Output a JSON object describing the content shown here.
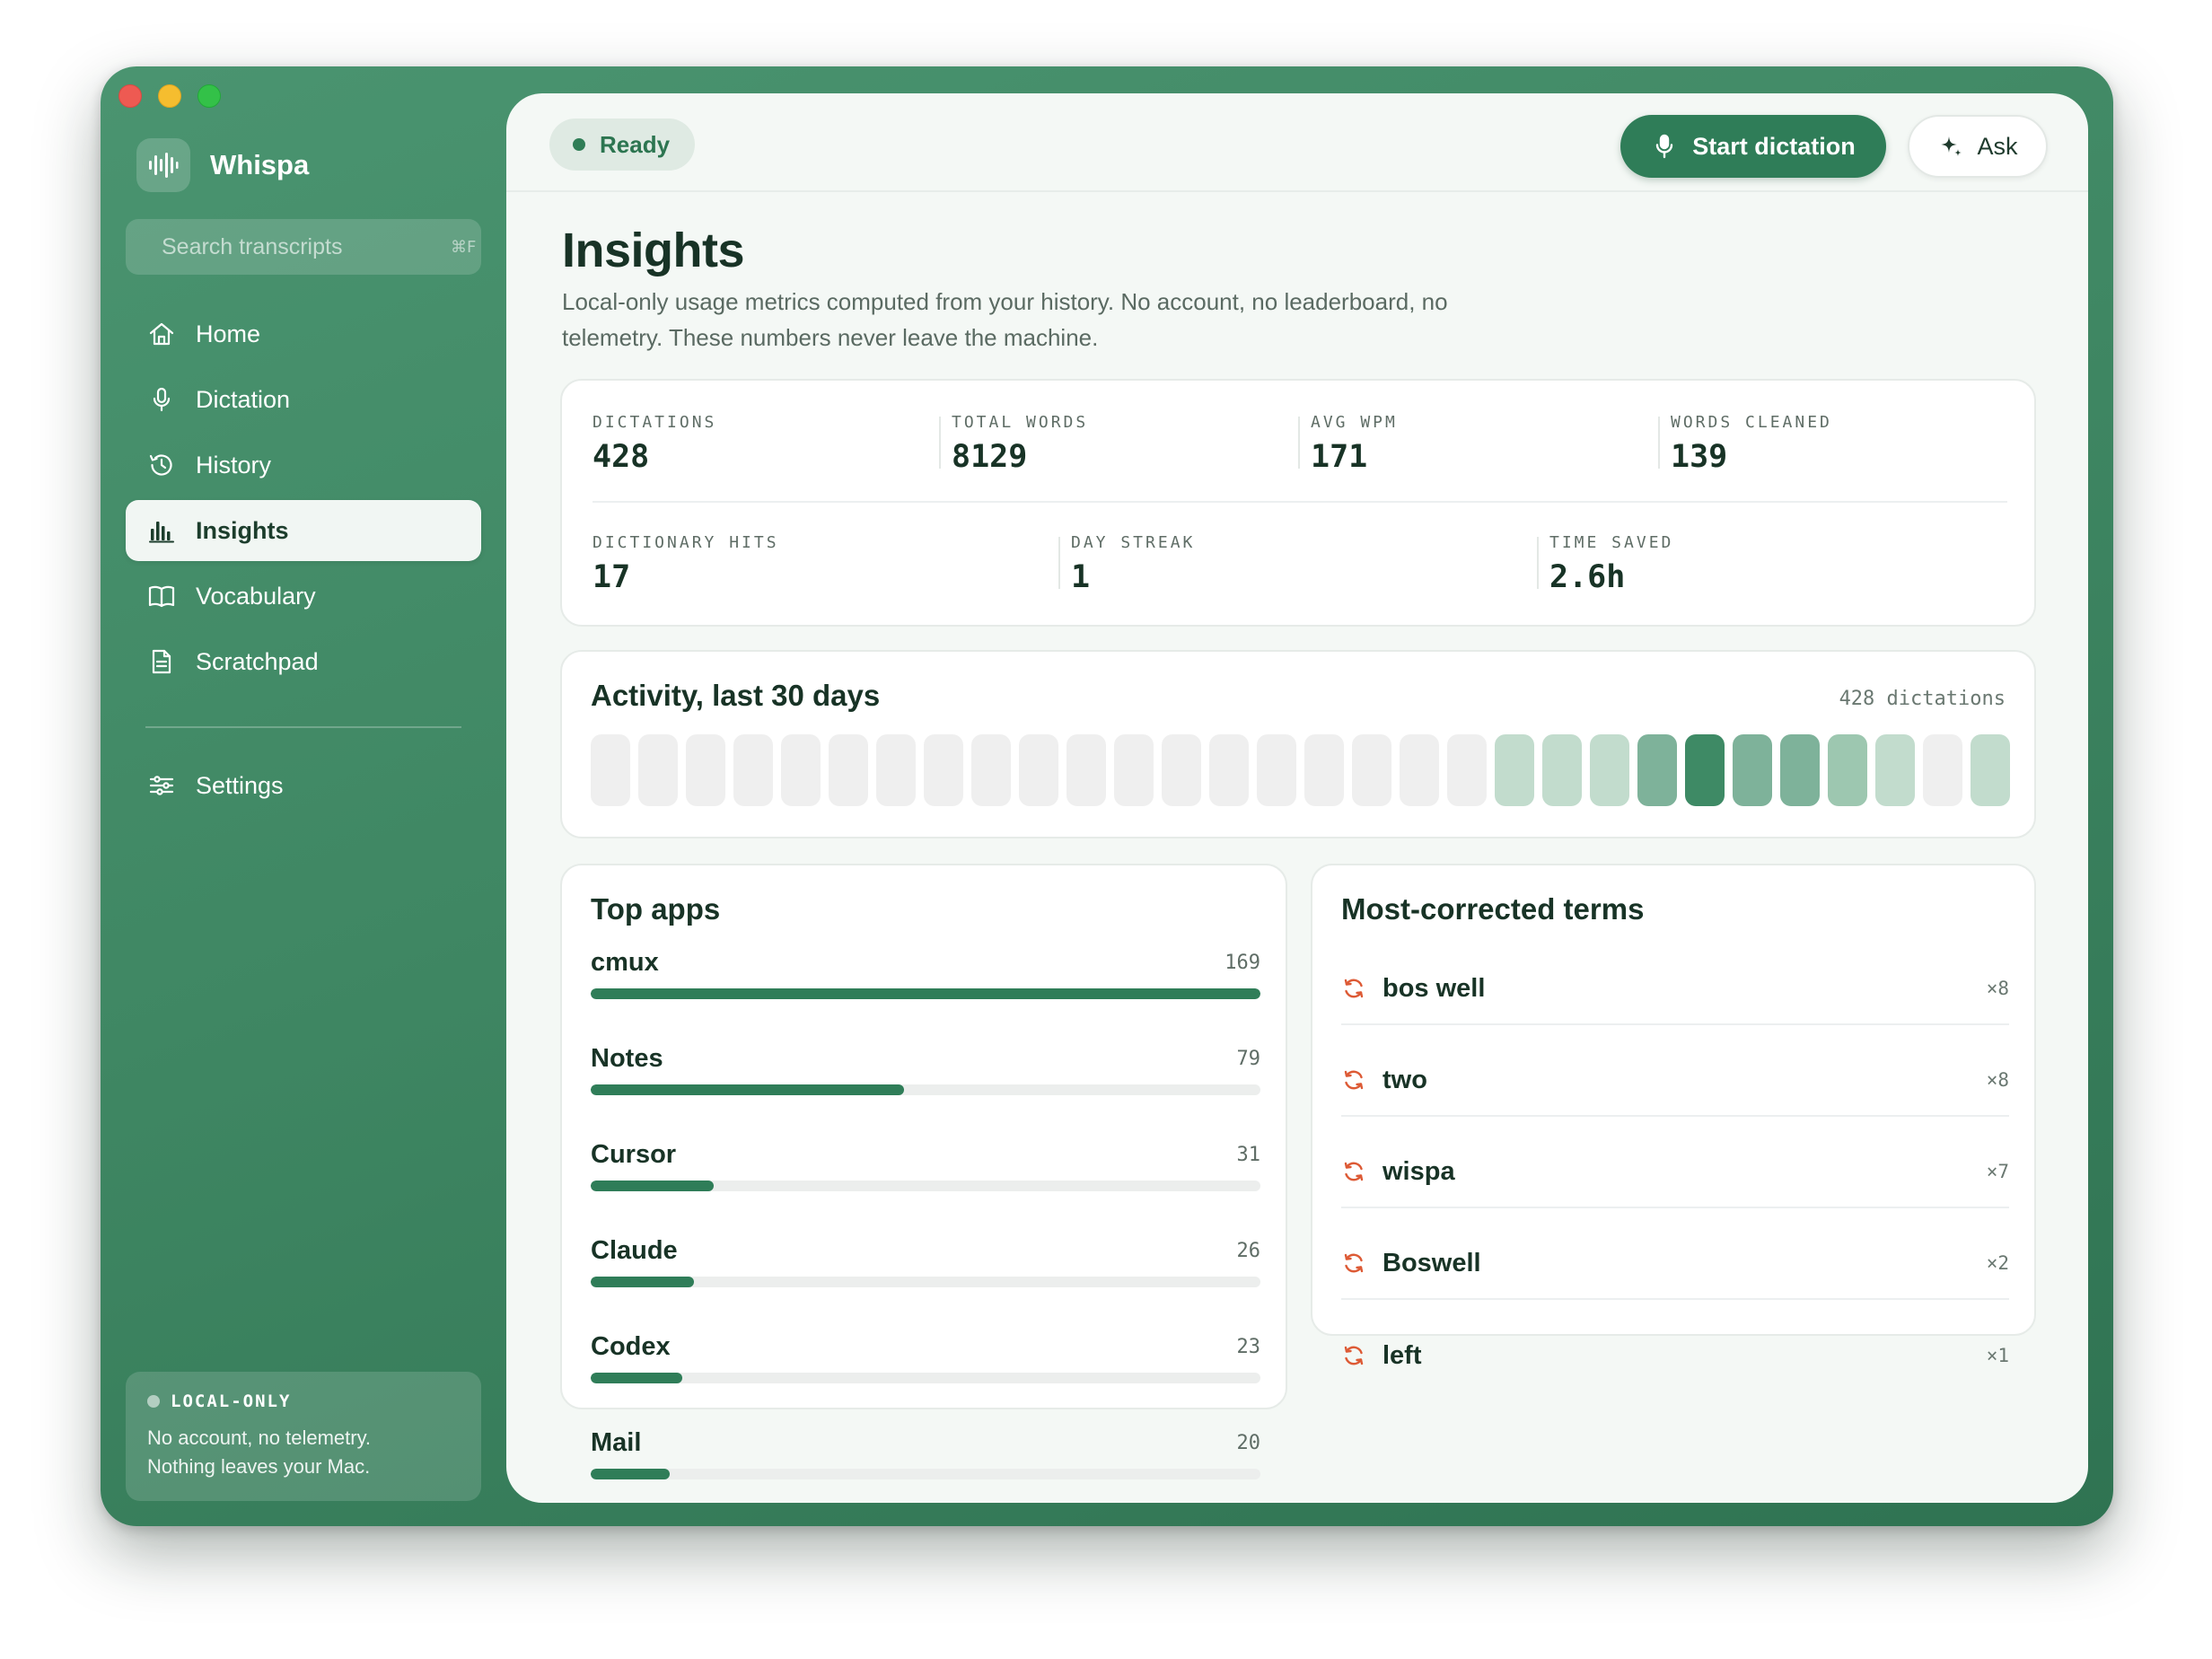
{
  "app": {
    "name": "Whispa"
  },
  "search": {
    "placeholder": "Search transcripts",
    "shortcut": "⌘F"
  },
  "sidebar": {
    "items": [
      {
        "label": "Home",
        "icon": "home-icon"
      },
      {
        "label": "Dictation",
        "icon": "microphone-icon"
      },
      {
        "label": "History",
        "icon": "history-icon"
      },
      {
        "label": "Insights",
        "icon": "bar-chart-icon",
        "active": true
      },
      {
        "label": "Vocabulary",
        "icon": "book-icon"
      },
      {
        "label": "Scratchpad",
        "icon": "document-icon"
      }
    ],
    "settings_label": "Settings",
    "local": {
      "title": "LOCAL-ONLY",
      "line1": "No account, no telemetry.",
      "line2": "Nothing leaves your Mac."
    }
  },
  "topbar": {
    "status": "Ready",
    "start_label": "Start dictation",
    "ask_label": "Ask"
  },
  "page": {
    "title": "Insights",
    "subtitle_line1": "Local-only usage metrics computed from your history. No account, no leaderboard, no",
    "subtitle_line2": "telemetry. These numbers never leave the machine."
  },
  "stats": [
    {
      "label": "DICTATIONS",
      "value": "428"
    },
    {
      "label": "TOTAL WORDS",
      "value": "8129"
    },
    {
      "label": "AVG WPM",
      "value": "171"
    },
    {
      "label": "WORDS CLEANED",
      "value": "139"
    },
    {
      "label": "DICTIONARY HITS",
      "value": "17"
    },
    {
      "label": "DAY STREAK",
      "value": "1"
    },
    {
      "label": "TIME SAVED",
      "value": "2.6h"
    }
  ],
  "activity": {
    "title": "Activity, last 30 days",
    "count_label": "428 dictations",
    "levels": [
      0,
      0,
      0,
      0,
      0,
      0,
      0,
      0,
      0,
      0,
      0,
      0,
      0,
      0,
      0,
      0,
      0,
      0,
      0,
      1,
      1,
      1,
      3,
      4,
      3,
      3,
      2,
      1,
      0,
      1
    ]
  },
  "colors": {
    "accent": "#2f7d58",
    "heat_levels": [
      "#efefef",
      "#c2dccd",
      "#9dc7b0",
      "#7eb29a",
      "#3e8a65"
    ],
    "term_icon": "#dd5a35"
  },
  "top_apps": {
    "title": "Top apps",
    "max": 169,
    "items": [
      {
        "name": "cmux",
        "count": 169
      },
      {
        "name": "Notes",
        "count": 79
      },
      {
        "name": "Cursor",
        "count": 31
      },
      {
        "name": "Claude",
        "count": 26
      },
      {
        "name": "Codex",
        "count": 23
      },
      {
        "name": "Mail",
        "count": 20
      }
    ]
  },
  "terms": {
    "title": "Most-corrected terms",
    "items": [
      {
        "term": "bos well",
        "count": "×8"
      },
      {
        "term": "two",
        "count": "×8"
      },
      {
        "term": "wispa",
        "count": "×7"
      },
      {
        "term": "Boswell",
        "count": "×2"
      },
      {
        "term": "left",
        "count": "×1"
      }
    ]
  }
}
